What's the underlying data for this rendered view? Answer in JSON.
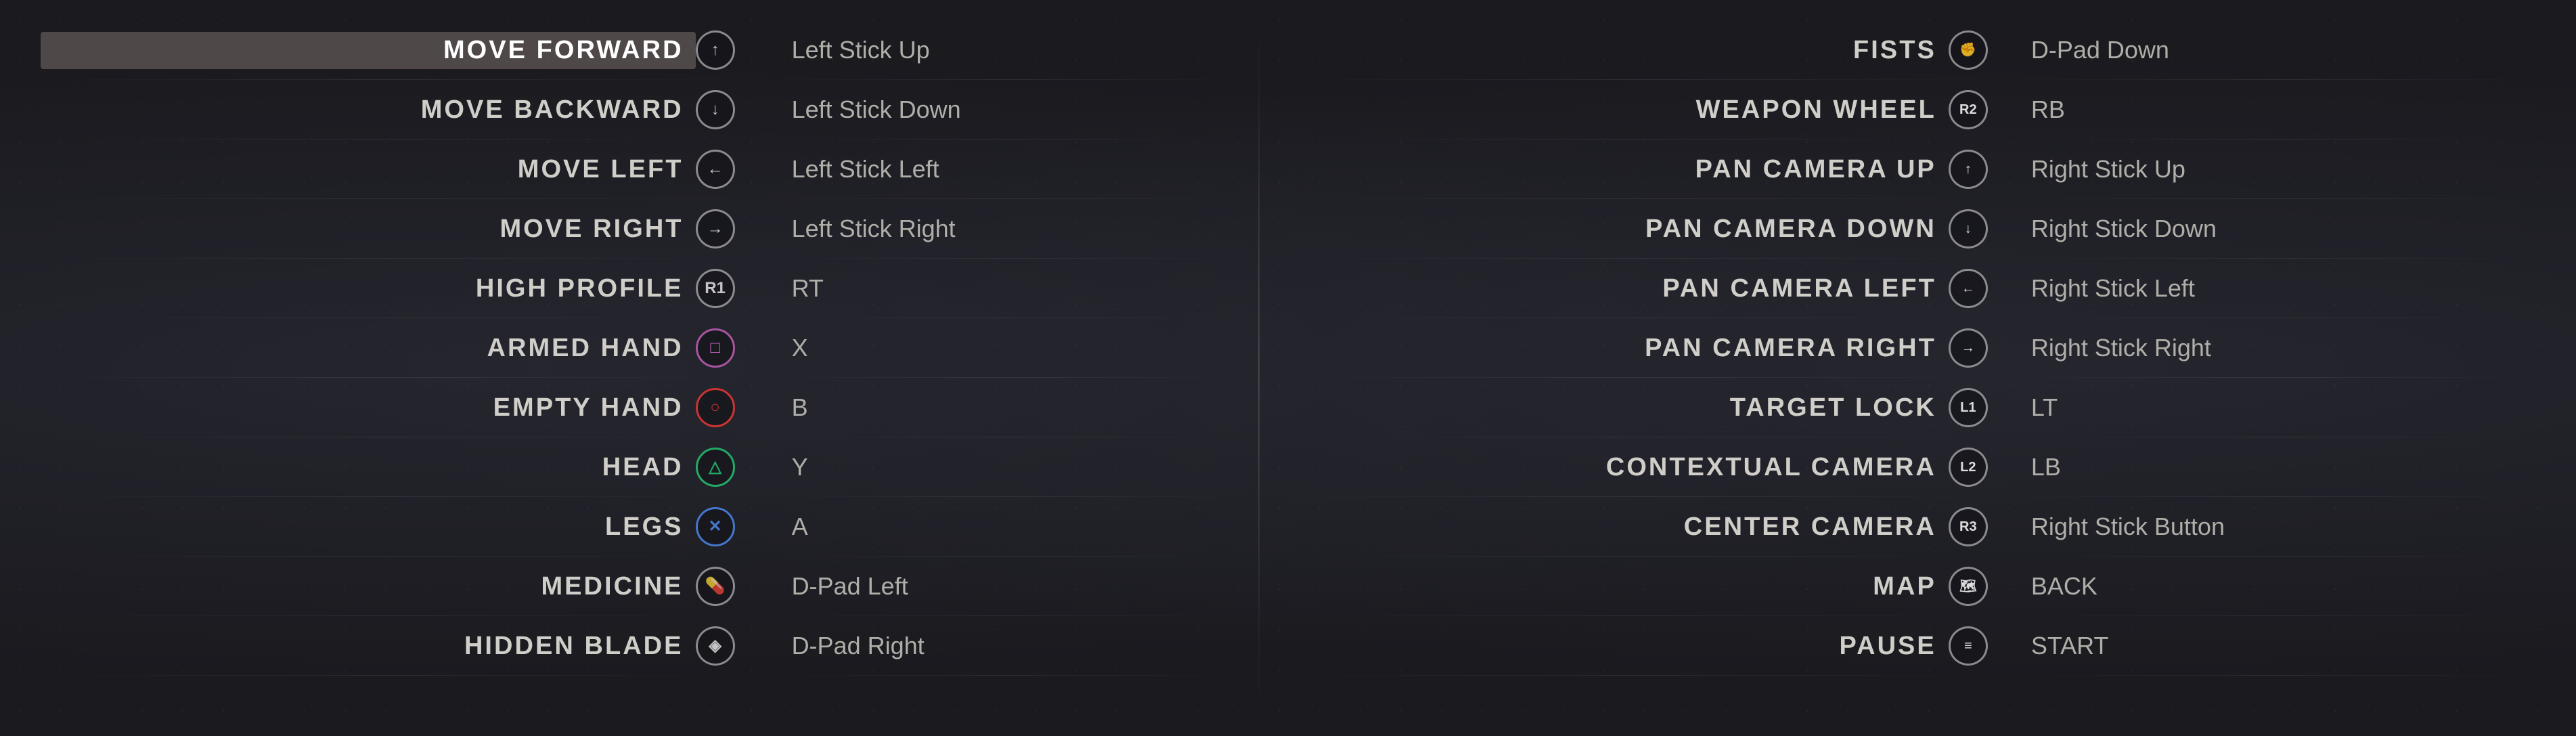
{
  "leftActions": [
    {
      "name": "MOVE FORWARD",
      "highlighted": true,
      "icon": "L",
      "iconClass": "l-btn",
      "symbol": "↑",
      "symbolClass": "",
      "binding": "Left Stick Up"
    },
    {
      "name": "MOVE BACKWARD",
      "highlighted": false,
      "icon": "L",
      "iconClass": "l-btn",
      "symbol": "↓",
      "symbolClass": "",
      "binding": "Left Stick Down"
    },
    {
      "name": "MOVE LEFT",
      "highlighted": false,
      "icon": "L",
      "iconClass": "l-btn",
      "symbol": "←",
      "symbolClass": "",
      "binding": "Left Stick Left"
    },
    {
      "name": "MOVE RIGHT",
      "highlighted": false,
      "icon": "L",
      "iconClass": "l-btn",
      "symbol": "→",
      "symbolClass": "",
      "binding": "Left Stick Right"
    },
    {
      "name": "HIGH PROFILE",
      "highlighted": false,
      "icon": "R1",
      "iconClass": "r1-btn",
      "symbol": "R1",
      "symbolClass": "",
      "binding": "RT"
    },
    {
      "name": "ARMED HAND",
      "highlighted": false,
      "icon": "□",
      "iconClass": "square-btn",
      "symbol": "□",
      "symbolClass": "square",
      "binding": "X"
    },
    {
      "name": "EMPTY HAND",
      "highlighted": false,
      "icon": "○",
      "iconClass": "circle-btn",
      "symbol": "○",
      "symbolClass": "circle",
      "binding": "B"
    },
    {
      "name": "HEAD",
      "highlighted": false,
      "icon": "△",
      "iconClass": "triangle-btn",
      "symbol": "△",
      "symbolClass": "triangle",
      "binding": "Y"
    },
    {
      "name": "LEGS",
      "highlighted": false,
      "icon": "✕",
      "iconClass": "cross-btn",
      "symbol": "✕",
      "symbolClass": "cross",
      "binding": "A"
    },
    {
      "name": "MEDICINE",
      "highlighted": false,
      "icon": "💊",
      "iconClass": "medicine-btn",
      "symbol": "💊",
      "symbolClass": "medicine",
      "binding": "D-Pad Left"
    },
    {
      "name": "HIDDEN BLADE",
      "highlighted": false,
      "icon": "◈",
      "iconClass": "l-btn",
      "symbol": "◈",
      "symbolClass": "",
      "binding": "D-Pad Right"
    }
  ],
  "rightActions": [
    {
      "name": "FISTS",
      "icon": "✊",
      "iconClass": "l-btn fist-btn",
      "symbol": "✊",
      "symbolClass": "fist",
      "binding": "D-Pad Down"
    },
    {
      "name": "WEAPON WHEEL",
      "icon": "R2",
      "iconClass": "r1-btn",
      "symbol": "R2",
      "symbolClass": "r2",
      "binding": "RB"
    },
    {
      "name": "PAN CAMERA UP",
      "icon": "R",
      "iconClass": "l-btn",
      "symbol": "↑",
      "symbolClass": "",
      "binding": "Right Stick Up"
    },
    {
      "name": "PAN CAMERA DOWN",
      "icon": "R",
      "iconClass": "l-btn",
      "symbol": "↓",
      "symbolClass": "",
      "binding": "Right Stick Down"
    },
    {
      "name": "PAN CAMERA LEFT",
      "icon": "R",
      "iconClass": "l-btn",
      "symbol": "←",
      "symbolClass": "",
      "binding": "Right Stick Left"
    },
    {
      "name": "PAN CAMERA RIGHT",
      "icon": "R",
      "iconClass": "l-btn",
      "symbol": "→",
      "symbolClass": "",
      "binding": "Right Stick Right"
    },
    {
      "name": "TARGET LOCK",
      "icon": "L1",
      "iconClass": "r1-btn",
      "symbol": "L1",
      "symbolClass": "l1",
      "binding": "LT"
    },
    {
      "name": "CONTEXTUAL CAMERA",
      "icon": "L2",
      "iconClass": "r1-btn",
      "symbol": "L2",
      "symbolClass": "l2",
      "binding": "LB"
    },
    {
      "name": "CENTER CAMERA",
      "icon": "R3",
      "iconClass": "r1-btn",
      "symbol": "R3",
      "symbolClass": "r3",
      "binding": "Right Stick Button"
    },
    {
      "name": "MAP",
      "icon": "🗺",
      "iconClass": "medicine-btn",
      "symbol": "🗺",
      "symbolClass": "map",
      "binding": "BACK"
    },
    {
      "name": "PAUSE",
      "icon": "≡",
      "iconClass": "l-btn",
      "symbol": "≡",
      "symbolClass": "",
      "binding": "START"
    }
  ]
}
